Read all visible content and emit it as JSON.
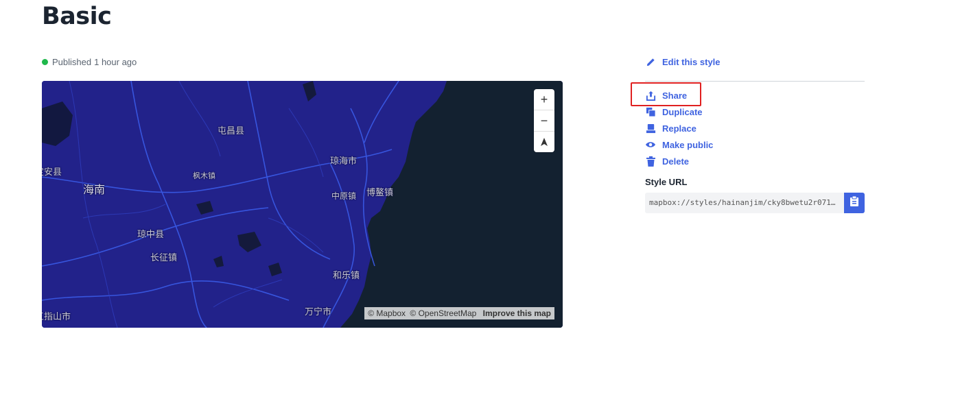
{
  "page": {
    "title": "Basic"
  },
  "status": {
    "text": "Published",
    "time": "1 hour ago",
    "color": "#1fb84b"
  },
  "map": {
    "colors": {
      "land": "#22228a",
      "water": "#132130",
      "roads": "#3a5be8",
      "minor_roads": "#2f3fc0"
    },
    "labels": [
      {
        "text": "屯昌县"
      },
      {
        "text": "琼海市"
      },
      {
        "text": "海南"
      },
      {
        "text": "枫木镇"
      },
      {
        "text": "定安县"
      },
      {
        "text": "博鳌镇"
      },
      {
        "text": "中原镇"
      },
      {
        "text": "琼中县"
      },
      {
        "text": "长征镇"
      },
      {
        "text": "和乐镇"
      },
      {
        "text": "万宁市"
      },
      {
        "text": "五指山市"
      }
    ],
    "controls": {
      "zoom_in": "+",
      "zoom_out": "−",
      "compass": "▲"
    },
    "attribution": {
      "mapbox": "© Mapbox",
      "osm": "© OpenStreetMap",
      "improve": "Improve this map"
    }
  },
  "actions": [
    {
      "label": "Edit this style",
      "icon": "pencil-icon"
    },
    {
      "label": "Share",
      "icon": "share-icon"
    },
    {
      "label": "Duplicate",
      "icon": "duplicate-icon"
    },
    {
      "label": "Replace",
      "icon": "replace-icon"
    },
    {
      "label": "Make public",
      "icon": "eye-icon"
    },
    {
      "label": "Delete",
      "icon": "trash-icon"
    }
  ],
  "style_url": {
    "label": "Style URL",
    "value": "mapbox://styles/hainanjim/cky8bwetu2r0714...",
    "copy_icon": "clipboard-icon"
  },
  "accent": "#3f63e0",
  "highlight_color": "#e02020"
}
